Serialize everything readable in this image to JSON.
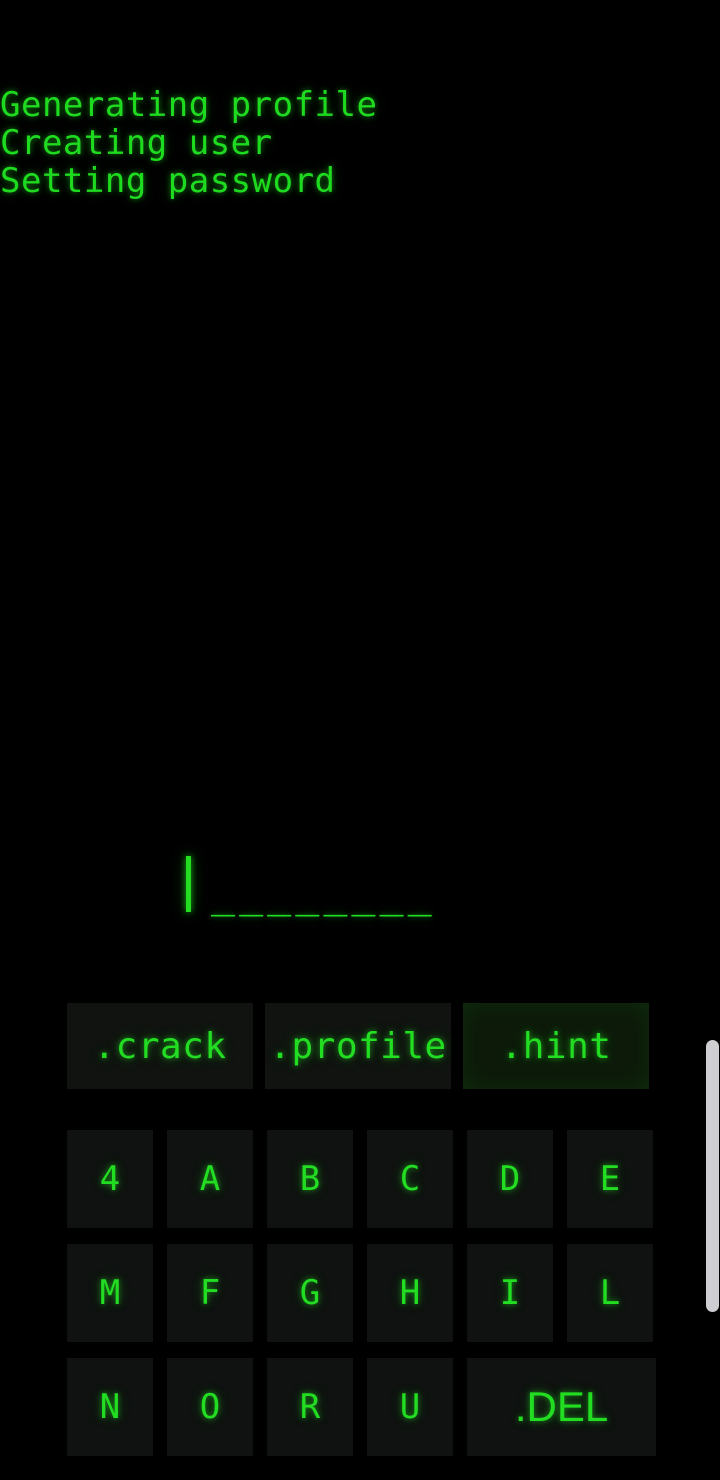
{
  "terminal": {
    "lines": [
      "Generating profile",
      "Creating user",
      "Setting password"
    ]
  },
  "password_field": {
    "cursor": "|",
    "slots": "________",
    "slot_count": 8
  },
  "commands": [
    {
      "label": ".crack",
      "name": "crack",
      "highlighted": false
    },
    {
      "label": ".profile",
      "name": "profile",
      "highlighted": false
    },
    {
      "label": ".hint",
      "name": "hint",
      "highlighted": true
    }
  ],
  "keyboard": {
    "rows": [
      [
        {
          "label": "4",
          "wide": false
        },
        {
          "label": "A",
          "wide": false
        },
        {
          "label": "B",
          "wide": false
        },
        {
          "label": "C",
          "wide": false
        },
        {
          "label": "D",
          "wide": false
        },
        {
          "label": "E",
          "wide": false
        }
      ],
      [
        {
          "label": "M",
          "wide": false
        },
        {
          "label": "F",
          "wide": false
        },
        {
          "label": "G",
          "wide": false
        },
        {
          "label": "H",
          "wide": false
        },
        {
          "label": "I",
          "wide": false
        },
        {
          "label": "L",
          "wide": false
        }
      ],
      [
        {
          "label": "N",
          "wide": false
        },
        {
          "label": "O",
          "wide": false
        },
        {
          "label": "R",
          "wide": false
        },
        {
          "label": "U",
          "wide": false
        },
        {
          "label": ".DEL",
          "wide": true
        }
      ]
    ]
  },
  "colors": {
    "background": "#000000",
    "terminal_green": "#22dd22",
    "key_background": "#0f1210",
    "command_background": "#101310",
    "command_highlight_background": "#0d1a0a",
    "scrollbar_thumb": "#cdcdd2"
  }
}
